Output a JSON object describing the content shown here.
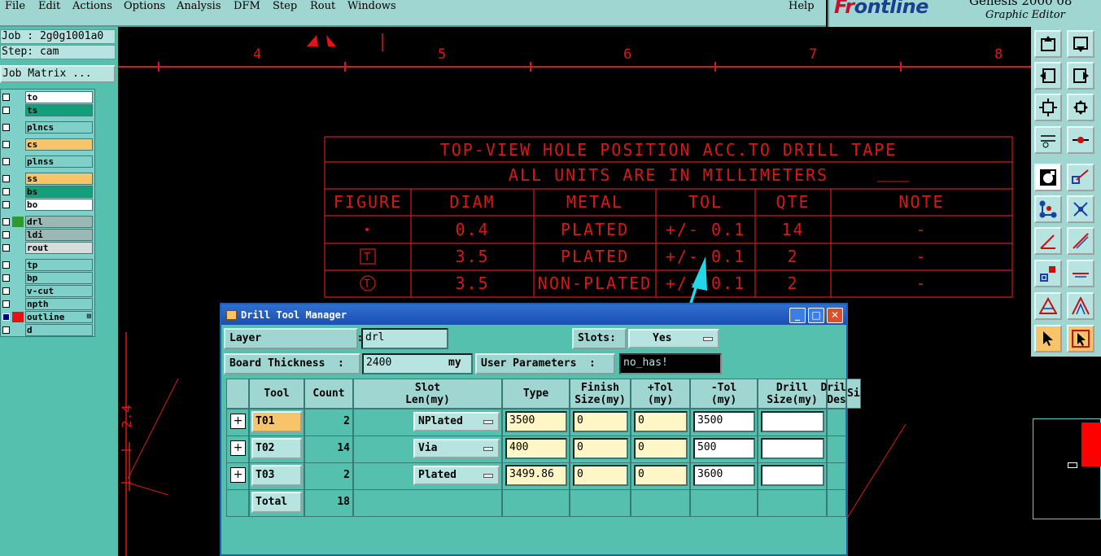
{
  "menu": {
    "items": [
      "File",
      "Edit",
      "Actions",
      "Options",
      "Analysis",
      "DFM",
      "Step",
      "Rout",
      "Windows"
    ],
    "help": "Help"
  },
  "brand": {
    "logo_first": "Fr",
    "logo_rest": "ontline",
    "product": "Genesis 2000",
    "version_fragment": "08",
    "subtitle": "Graphic Editor"
  },
  "job_info": {
    "job": "Job : 2g0g1001a0",
    "step": "Step: cam",
    "matrix_button": "Job Matrix ..."
  },
  "layers": [
    {
      "name": "to",
      "bg": "#ffffff",
      "swatch": null,
      "checked": false
    },
    {
      "name": "ts",
      "bg": "#12a07a",
      "swatch": null,
      "checked": false
    },
    {
      "name": "plncs",
      "bg": "#7fd0c8",
      "swatch": null,
      "checked": false
    },
    {
      "name": "cs",
      "bg": "#f7c46a",
      "swatch": null,
      "checked": false
    },
    {
      "name": "plnss",
      "bg": "#7fd0c8",
      "swatch": null,
      "checked": false
    },
    {
      "name": "ss",
      "bg": "#f7c46a",
      "swatch": null,
      "checked": false
    },
    {
      "name": "bs",
      "bg": "#12a07a",
      "swatch": null,
      "checked": false
    },
    {
      "name": "bo",
      "bg": "#ffffff",
      "swatch": null,
      "checked": false
    },
    {
      "name": "drl",
      "bg": "#9bb8b4",
      "swatch": "#2e9a2e",
      "checked": false
    },
    {
      "name": "ldi",
      "bg": "#9bb8b4",
      "swatch": null,
      "checked": false
    },
    {
      "name": "rout",
      "bg": "#d8dcdc",
      "swatch": null,
      "checked": false
    },
    {
      "name": "tp",
      "bg": "#7fd0c8",
      "swatch": null,
      "checked": false
    },
    {
      "name": "bp",
      "bg": "#7fd0c8",
      "swatch": null,
      "checked": false
    },
    {
      "name": "v-cut",
      "bg": "#7fd0c8",
      "swatch": null,
      "checked": false
    },
    {
      "name": "npth",
      "bg": "#7fd0c8",
      "swatch": null,
      "checked": false
    },
    {
      "name": "outline",
      "bg": "#7fd0c8",
      "swatch": "#e81010",
      "checked": true,
      "mark": "⊞"
    },
    {
      "name": "d",
      "bg": "#7fd0c8",
      "swatch": null,
      "checked": false
    }
  ],
  "canvas": {
    "ruler_labels": [
      "4",
      "5",
      "6",
      "7",
      "8"
    ],
    "vertical_dim": "2.4",
    "drawing_color": "#d81818",
    "table_title": "TOP-VIEW HOLE POSITION ACC.TO DRILL TAPE",
    "table_subtitle": "ALL UNITS ARE IN MILLIMETERS",
    "headers": [
      "FIGURE",
      "DIAM",
      "METAL",
      "TOL",
      "QTE",
      "NOTE"
    ],
    "rows": [
      {
        "figure": "•",
        "diam": "0.4",
        "metal": "PLATED",
        "tol": "+/- 0.1",
        "qte": "14",
        "note": "-"
      },
      {
        "figure": "T",
        "diam": "3.5",
        "metal": "PLATED",
        "tol": "+/- 0.1",
        "qte": "2",
        "note": "-"
      },
      {
        "figure": "T",
        "diam": "3.5",
        "metal": "NON-PLATED",
        "tol": "+/- 0.1",
        "qte": "2",
        "note": "-"
      }
    ],
    "annotation_color": "#22d8e8"
  },
  "dialog": {
    "title": "Drill Tool Manager",
    "layer_label": "Layer               :",
    "layer_value": "drl",
    "slots_label": "Slots:",
    "slots_value": "Yes",
    "thickness_label": "Board Thickness  :",
    "thickness_value": "2400",
    "thickness_unit": "my",
    "user_params_label": "User Parameters  :",
    "user_params_value": "no_has!",
    "columns": [
      "Tool",
      "Count",
      "Slot\nLen(my)",
      "Type",
      "Finish\nSize(my)",
      "+Tol\n(my)",
      "-Tol\n(my)",
      "Drill\nSize(my)",
      "Drill\nDes",
      "Si"
    ],
    "rows": [
      {
        "tool": "T01",
        "count": "2",
        "type": "NPlated",
        "finish": "3500",
        "ptol": "0",
        "mtol": "0",
        "drill": "3500",
        "des": "",
        "selected": true
      },
      {
        "tool": "T02",
        "count": "14",
        "type": "Via",
        "finish": "400",
        "ptol": "0",
        "mtol": "0",
        "drill": "500",
        "des": "",
        "selected": false
      },
      {
        "tool": "T03",
        "count": "2",
        "type": "Plated",
        "finish": "3499.86",
        "ptol": "0",
        "mtol": "0",
        "drill": "3600",
        "des": "",
        "selected": false
      }
    ],
    "total_label": "Total",
    "total_count": "18"
  }
}
